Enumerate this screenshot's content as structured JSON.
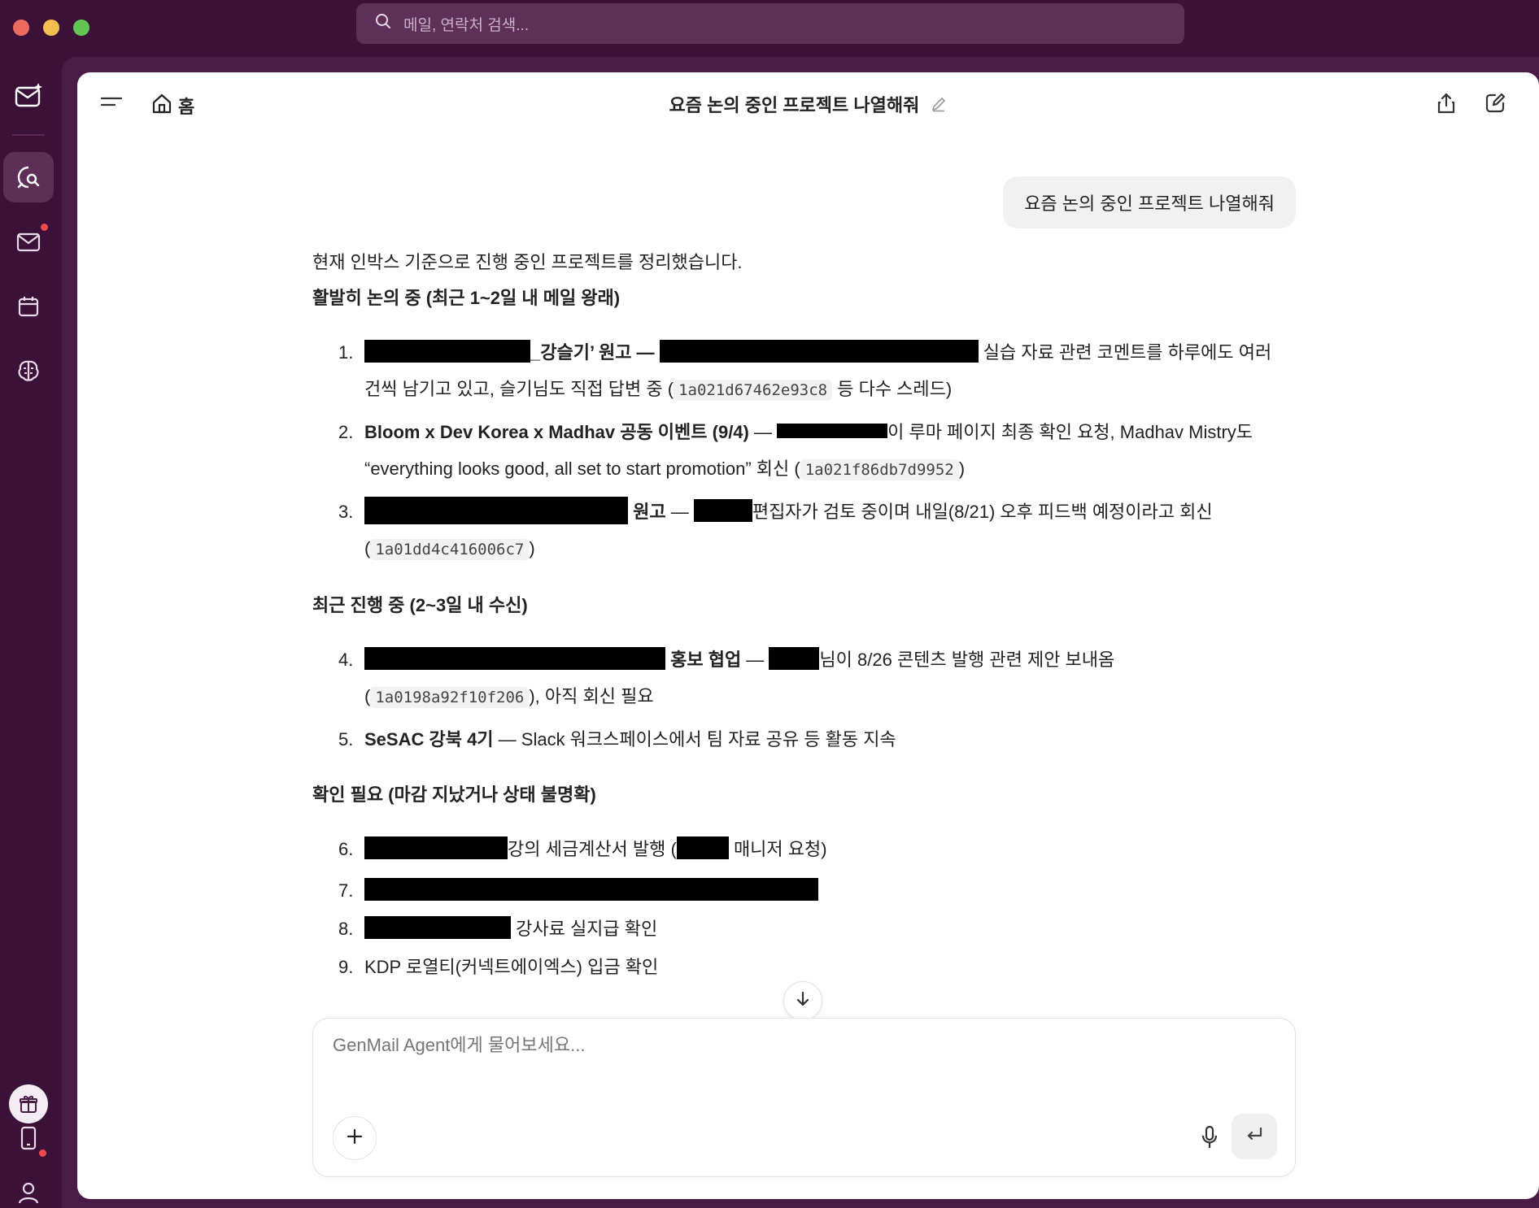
{
  "search": {
    "placeholder": "메일, 연락처 검색..."
  },
  "rail": {
    "items": [
      "mail-star-icon",
      "chat-search-icon",
      "mail-icon",
      "calendar-icon",
      "brain-icon",
      "gift-icon",
      "phone-icon",
      "user-icon"
    ]
  },
  "header": {
    "home_label": "홈",
    "title": "요즘 논의 중인 프로젝트 나열해줘"
  },
  "user_message": "요즘 논의 중인 프로젝트 나열해줘",
  "answer": {
    "intro": "현재 인박스 기준으로 진행 중인 프로젝트를 정리했습니다.",
    "section1": "활발히 논의 중 (최근 1~2일 내 메일 왕래)",
    "item1": {
      "num": "1.",
      "title": "_강슬기’ 원고 —",
      "desc_a": " 실습 자료 관련 코멘트를 하루에도 여러 건씩 남기고 있고, 슬기님도 직접 답변 중 (",
      "code": "1a021d67462e93c8",
      "desc_b": " 등 다수 스레드)"
    },
    "item2": {
      "num": "2.",
      "title": "Bloom x Dev Korea x Madhav 공동 이벤트 (9/4)",
      "sep": " — ",
      "desc_a": "이 루마 페이지 최종 확인 요청, Madhav Mistry도 “everything looks good, all set to start promotion” 회신 (",
      "code": "1a021f86db7d9952",
      "desc_b": ")"
    },
    "item3": {
      "num": "3.",
      "title": " 원고",
      "sep": " — ",
      "desc_a": "편집자가 검토 중이며 내일(8/21) 오후 피드백 예정이라고 회신 (",
      "code": "1a01dd4c416006c7",
      "desc_b": ")"
    },
    "section2": "최근 진행 중 (2~3일 내 수신)",
    "item4": {
      "num": "4.",
      "title": " 홍보 협업",
      "sep": " — ",
      "desc_a": "님이 8/26 콘텐츠 발행 관련 제안 보내옴 (",
      "code": "1a0198a92f10f206",
      "desc_b": "), 아직 회신 필요"
    },
    "item5": {
      "num": "5.",
      "title": "SeSAC 강북 4기",
      "desc": " — Slack 워크스페이스에서 팀 자료 공유 등 활동 지속"
    },
    "section3": "확인 필요 (마감 지났거나 상태 불명확)",
    "item6": {
      "num": "6.",
      "desc_a": "강의 세금계산서 발행 (",
      "desc_b": " 매니저 요청)"
    },
    "item7": {
      "num": "7."
    },
    "item8": {
      "num": "8.",
      "desc": " 강사료 실지급 확인"
    },
    "item9": {
      "num": "9.",
      "desc": "KDP 로열티(커넥트에이엑스) 입금 확인"
    }
  },
  "composer": {
    "placeholder": "GenMail Agent에게 물어보세요..."
  }
}
